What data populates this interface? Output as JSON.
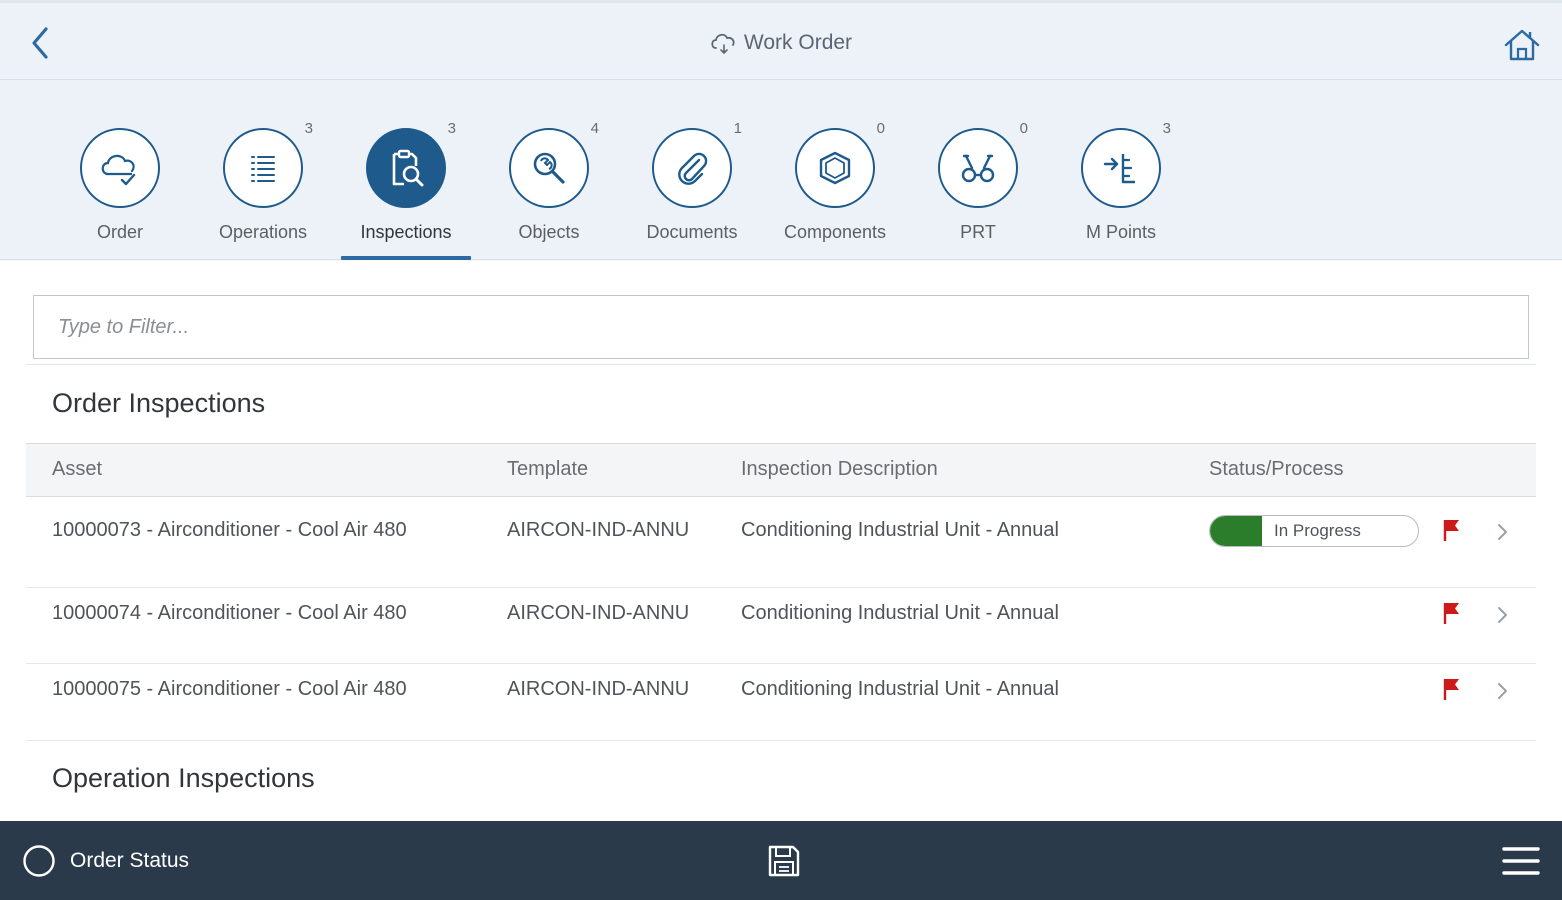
{
  "header": {
    "title": "Work Order",
    "title_icon": "cloud-icon",
    "back_icon": "chevron-left-icon",
    "home_icon": "home-icon"
  },
  "tabs": [
    {
      "label": "Order",
      "count": "",
      "icon": "cloud-check-icon",
      "active": false
    },
    {
      "label": "Operations",
      "count": "3",
      "icon": "list-icon",
      "active": false
    },
    {
      "label": "Inspections",
      "count": "3",
      "icon": "inspect-icon",
      "active": true
    },
    {
      "label": "Objects",
      "count": "4",
      "icon": "search-wrench-icon",
      "active": false
    },
    {
      "label": "Documents",
      "count": "1",
      "icon": "paperclip-icon",
      "active": false
    },
    {
      "label": "Components",
      "count": "0",
      "icon": "cube-icon",
      "active": false
    },
    {
      "label": "PRT",
      "count": "0",
      "icon": "tools-icon",
      "active": false
    },
    {
      "label": "M Points",
      "count": "3",
      "icon": "measure-points-icon",
      "active": false
    }
  ],
  "filter": {
    "placeholder": "Type to Filter..."
  },
  "order_inspections": {
    "title": "Order Inspections",
    "columns": [
      "Asset",
      "Template",
      "Inspection Description",
      "Status/Process"
    ],
    "rows": [
      {
        "asset": "10000073 - Airconditioner - Cool Air 480",
        "template": "AIRCON-IND-ANNU",
        "description": "Conditioning Industrial Unit - Annual",
        "status": "In Progress",
        "progress": 0.25,
        "flagged": true
      },
      {
        "asset": "10000074 - Airconditioner - Cool Air 480",
        "template": "AIRCON-IND-ANNU",
        "description": "Conditioning Industrial Unit - Annual",
        "status": "",
        "flagged": true
      },
      {
        "asset": "10000075 - Airconditioner - Cool Air 480",
        "template": "AIRCON-IND-ANNU",
        "description": "Conditioning Industrial Unit - Annual",
        "status": "",
        "flagged": true
      }
    ]
  },
  "operation_inspections": {
    "title": "Operation Inspections"
  },
  "footer": {
    "order_status_label": "Order Status",
    "save_icon": "save-icon",
    "menu_icon": "hamburger-menu-icon"
  },
  "colors": {
    "accent": "#1e5a8c",
    "footer_bg": "#2a3a4a",
    "progress_green": "#2b7d2b",
    "flag_red": "#cc1919"
  }
}
